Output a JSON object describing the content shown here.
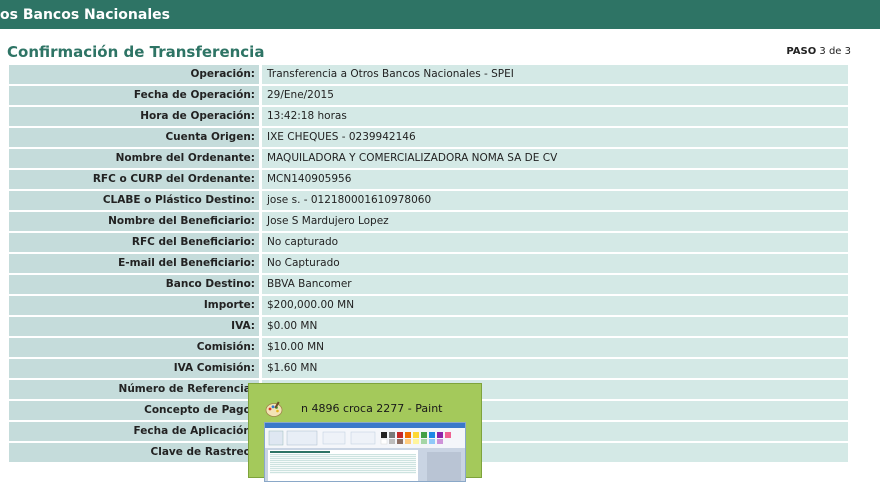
{
  "header": {
    "title": "os Bancos Nacionales"
  },
  "section": {
    "title": "Confirmación de Transferencia"
  },
  "step": {
    "label": "PASO",
    "text": "3 de 3"
  },
  "rows": [
    {
      "label": "Operación:",
      "value": "Transferencia a Otros Bancos Nacionales - SPEI"
    },
    {
      "label": "Fecha de Operación:",
      "value": "29/Ene/2015"
    },
    {
      "label": "Hora de Operación:",
      "value": "13:42:18 horas"
    },
    {
      "label": "Cuenta Origen:",
      "value": "IXE CHEQUES - 0239942146"
    },
    {
      "label": "Nombre del Ordenante:",
      "value": "MAQUILADORA Y COMERCIALIZADORA NOMA SA DE CV"
    },
    {
      "label": "RFC o CURP del Ordenante:",
      "value": "MCN140905956"
    },
    {
      "label": "CLABE o Plástico Destino:",
      "value": "jose s. - 012180001610978060"
    },
    {
      "label": "Nombre del Beneficiario:",
      "value": "Jose S Mardujero Lopez"
    },
    {
      "label": "RFC del Beneficiario:",
      "value": "No capturado"
    },
    {
      "label": "E-mail del Beneficiario:",
      "value": "No Capturado"
    },
    {
      "label": "Banco Destino:",
      "value": "BBVA Bancomer"
    },
    {
      "label": "Importe:",
      "value": "$200,000.00 MN"
    },
    {
      "label": "IVA:",
      "value": "$0.00 MN"
    },
    {
      "label": "Comisión:",
      "value": "$10.00 MN"
    },
    {
      "label": "IVA Comisión:",
      "value": "$1.60 MN"
    },
    {
      "label": "Número de Referencia:",
      "value": ""
    },
    {
      "label": "Concepto de Pago:",
      "value": ""
    },
    {
      "label": "Fecha de Aplicación:",
      "value": ""
    },
    {
      "label": "Clave de Rastreo:",
      "value": ""
    }
  ],
  "taskbar_preview": {
    "title": "n 4896 croca 2277 - Paint",
    "icon": "paint-palette-icon"
  },
  "colors": {
    "header_bg": "#2e7465",
    "title_color": "#2e7465",
    "label_bg": "#c5dcdb",
    "value_bg": "#d4e9e6",
    "popup_bg": "#a4c95b"
  }
}
